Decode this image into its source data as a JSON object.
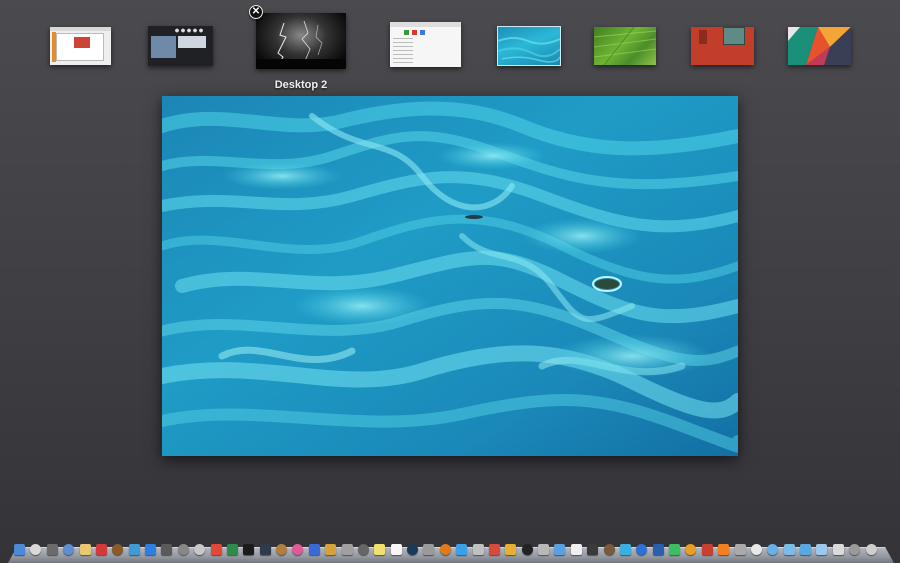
{
  "mission_control": {
    "spaces": [
      {
        "id": "space-1",
        "kind": "app-window"
      },
      {
        "id": "space-2",
        "kind": "dark-panel"
      },
      {
        "id": "desktop-2",
        "kind": "lightning",
        "label": "Desktop 2",
        "close_glyph": "✕"
      },
      {
        "id": "space-4",
        "kind": "finder-window"
      },
      {
        "id": "space-5",
        "kind": "ocean-wallpaper",
        "selected": true
      },
      {
        "id": "space-6",
        "kind": "green-field"
      },
      {
        "id": "space-7",
        "kind": "red-wall"
      },
      {
        "id": "space-8",
        "kind": "geometric"
      }
    ],
    "current_desktop": "ocean-wallpaper"
  },
  "colors": {
    "background": "#404045",
    "ocean_deep": "#1478a8",
    "ocean_light": "#39c8e0",
    "dock_shelf": "#b7bcc5"
  },
  "dock": {
    "icons": [
      "finder-icon",
      "safari-icon",
      "photo-icon",
      "mail-icon",
      "notes-icon",
      "calendar-icon",
      "book-icon",
      "itunes-icon",
      "appstore-icon",
      "compass-icon",
      "system-icon",
      "photobooth-icon",
      "chrome-icon",
      "maps-icon",
      "terminal-icon",
      "activity-icon",
      "guitar-icon",
      "music-icon",
      "xcode-icon",
      "preview-icon",
      "camera-icon",
      "calculator-icon",
      "stickies-icon",
      "textedit-icon",
      "quicktime-icon",
      "preferences-icon",
      "firefox-icon",
      "twitter-icon",
      "keychain-icon",
      "news-icon",
      "picasa-icon",
      "clock-icon",
      "utility-icon",
      "network-icon",
      "chart-icon",
      "monitor-icon",
      "contacts-icon",
      "messages-icon",
      "globe-icon",
      "word-icon",
      "facetime-icon",
      "sketch-icon",
      "office-icon",
      "vlc-icon",
      "gear-icon",
      "pages-icon",
      "folder-icon",
      "folder-icon-2",
      "downloads-icon",
      "documents-icon",
      "stack-icon",
      "image-stack-icon",
      "trash-icon"
    ]
  }
}
